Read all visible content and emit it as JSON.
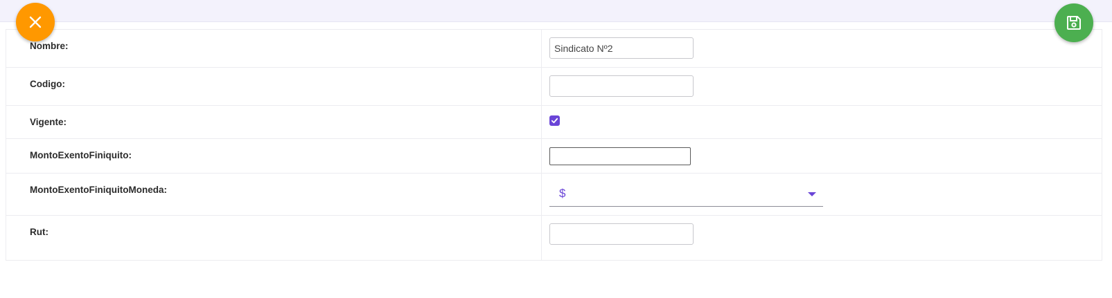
{
  "header": {
    "close_icon": "close-icon",
    "save_icon": "floppy-disk-icon",
    "close_color": "#ff9800",
    "save_color": "#4caf50"
  },
  "form": {
    "fields": [
      {
        "label": "Nombre:",
        "value": "Sindicato Nº2",
        "type": "text"
      },
      {
        "label": "Codigo:",
        "value": "",
        "type": "text"
      },
      {
        "label": "Vigente:",
        "checked": true,
        "type": "checkbox"
      },
      {
        "label": "MontoExentoFiniquito:",
        "value": "",
        "type": "text"
      },
      {
        "label": "MontoExentoFiniquitoMoneda:",
        "value": "$",
        "type": "select"
      },
      {
        "label": "Rut:",
        "value": "",
        "type": "text"
      }
    ]
  },
  "colors": {
    "accent": "#6a45d7",
    "background": "#f3f2fc"
  }
}
